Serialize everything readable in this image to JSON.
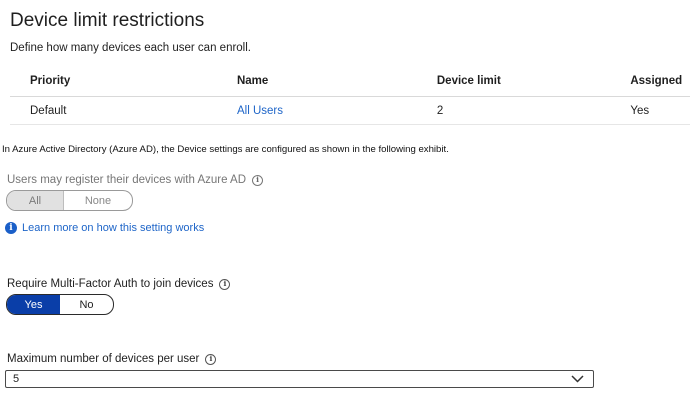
{
  "title": "Device limit restrictions",
  "subtitle": "Define how many devices each user can enroll.",
  "table": {
    "headers": [
      "Priority",
      "Name",
      "Device limit",
      "Assigned"
    ],
    "rows": [
      {
        "priority": "Default",
        "name": "All Users",
        "device_limit": "2",
        "assigned": "Yes"
      }
    ]
  },
  "exhibit_text": "In Azure Active Directory (Azure AD), the Device settings are configured as shown in the following exhibit.",
  "register": {
    "label": "Users may register their devices with Azure AD",
    "options": [
      "All",
      "None"
    ],
    "selected": "All",
    "disabled": true
  },
  "learn_more": "Learn more on how this setting works",
  "mfa": {
    "label": "Require Multi-Factor Auth to join devices",
    "options": [
      "Yes",
      "No"
    ],
    "selected": "Yes"
  },
  "max_devices": {
    "label": "Maximum number of devices per user",
    "value": "5"
  },
  "colors": {
    "link": "#1e65c8",
    "toggle_on": "#0a3ea8"
  }
}
